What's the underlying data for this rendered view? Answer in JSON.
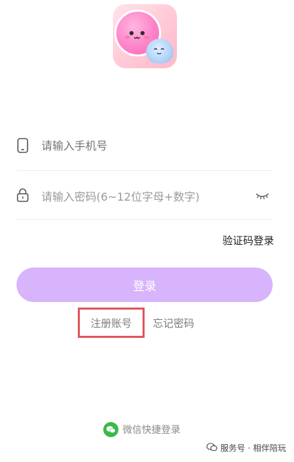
{
  "form": {
    "phone_placeholder": "请输入手机号",
    "password_placeholder": "请输入密码(6~12位字母+数字)",
    "code_login_link": "验证码登录",
    "login_button": "登录",
    "register_link": "注册账号",
    "forgot_link": "忘记密码"
  },
  "wechat_login": {
    "label": "微信快捷登录"
  },
  "watermark": {
    "text": "服务号 · 相伴陪玩"
  },
  "colors": {
    "login_button": "#d8b4fc",
    "highlight_border": "#e0555d",
    "wechat_green": "#3cb849"
  },
  "icons": [
    "phone-icon",
    "lock-icon",
    "eye-closed-icon",
    "wechat-icon"
  ]
}
